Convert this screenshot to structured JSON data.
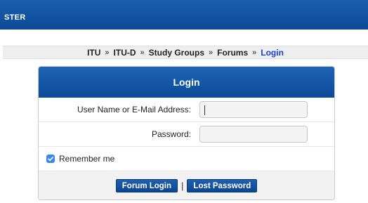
{
  "header": {
    "title_fragment": "STER"
  },
  "breadcrumb": {
    "items": [
      "ITU",
      "ITU-D",
      "Study Groups",
      "Forums"
    ],
    "current": "Login",
    "separator": "»"
  },
  "login": {
    "title": "Login",
    "username_label": "User Name or E-Mail Address:",
    "username_value": "",
    "password_label": "Password:",
    "password_value": "",
    "remember_label": "Remember me",
    "remember_checked": true,
    "login_button": "Forum Login",
    "divider": "|",
    "lost_password_button": "Lost Password"
  },
  "colors": {
    "header_blue": "#0b4a96",
    "breadcrumb_current": "#1a3cd6",
    "checkbox_blue": "#3b86e8"
  }
}
